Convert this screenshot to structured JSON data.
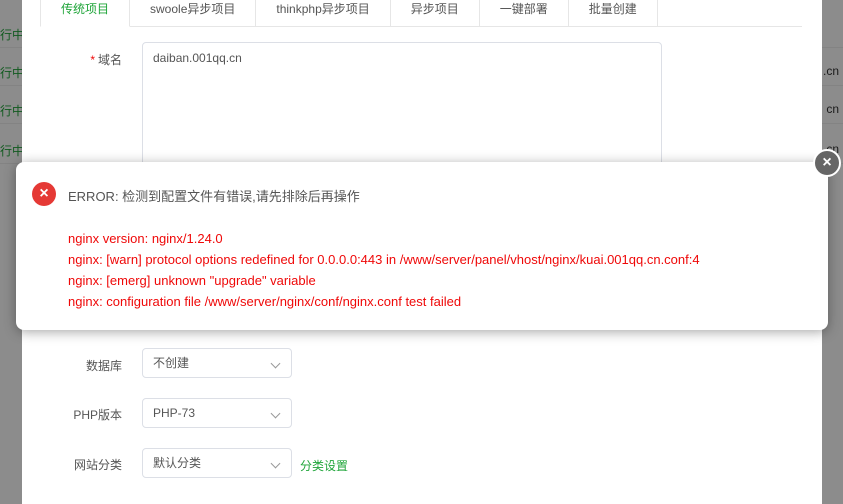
{
  "background_list": {
    "rows": [
      {
        "status": "行中",
        "domain": ""
      },
      {
        "status": "行中",
        "domain": ".cn"
      },
      {
        "status": "行中",
        "domain": "cn"
      },
      {
        "status": "行中",
        "domain": "cn"
      }
    ]
  },
  "dialog": {
    "tabs": [
      {
        "label": "传统项目",
        "active": true
      },
      {
        "label": "swoole异步项目"
      },
      {
        "label": "thinkphp异步项目"
      },
      {
        "label": "异步项目"
      },
      {
        "label": "一键部署"
      },
      {
        "label": "批量创建"
      }
    ],
    "domain": {
      "label": "域名",
      "required_mark": "*",
      "value": "daiban.001qq.cn"
    },
    "database": {
      "label": "数据库",
      "value": "不创建"
    },
    "php_version": {
      "label": "PHP版本",
      "value": "PHP-73"
    },
    "site_category": {
      "label": "网站分类",
      "value": "默认分类",
      "settings_link": "分类设置"
    }
  },
  "error_toast": {
    "title": "ERROR: 检测到配置文件有错误,请先排除后再操作",
    "lines": [
      "nginx version: nginx/1.24.0",
      "nginx: [warn] protocol options redefined for 0.0.0.0:443 in /www/server/panel/vhost/nginx/kuai.001qq.cn.conf:4",
      "nginx: [emerg] unknown \"upgrade\" variable",
      "nginx: configuration file /www/server/nginx/conf/nginx.conf test failed"
    ],
    "icon": "error-icon",
    "close_icon": "close-icon"
  },
  "colors": {
    "accent": "#20a53a",
    "error": "#ef0808",
    "error_icon": "#e53935"
  }
}
